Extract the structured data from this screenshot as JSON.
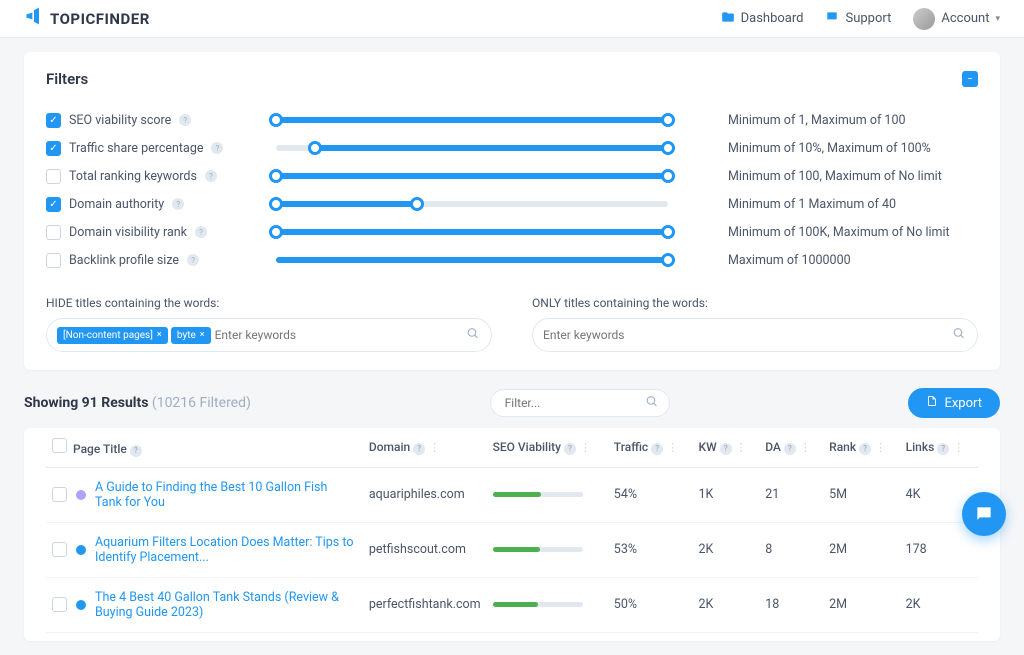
{
  "brand": "TOPICFINDER",
  "nav": {
    "dashboard": "Dashboard",
    "support": "Support",
    "account": "Account"
  },
  "filters": {
    "title": "Filters",
    "rows": [
      {
        "label": "SEO viability score",
        "checked": true,
        "fillLeft": 0,
        "fillRight": 100,
        "handles": [
          0,
          100
        ],
        "desc": "Minimum of 1, Maximum of 100"
      },
      {
        "label": "Traffic share percentage",
        "checked": true,
        "fillLeft": 10,
        "fillRight": 100,
        "handles": [
          10,
          100
        ],
        "desc": "Minimum of 10%, Maximum of 100%"
      },
      {
        "label": "Total ranking keywords",
        "checked": false,
        "fillLeft": 0,
        "fillRight": 100,
        "handles": [
          0,
          100
        ],
        "desc": "Minimum of 100, Maximum of No limit"
      },
      {
        "label": "Domain authority",
        "checked": true,
        "fillLeft": 0,
        "fillRight": 36,
        "handles": [
          0,
          36
        ],
        "desc": "Minimum of 1 Maximum of 40"
      },
      {
        "label": "Domain visibility rank",
        "checked": false,
        "fillLeft": 0,
        "fillRight": 100,
        "handles": [
          0,
          100
        ],
        "desc": "Minimum of 100K, Maximum of No limit"
      },
      {
        "label": "Backlink profile size",
        "checked": false,
        "fillLeft": 0,
        "fillRight": 100,
        "handles": [
          100
        ],
        "desc": "Maximum of 1000000"
      }
    ],
    "hide": {
      "label": "HIDE titles containing the words:",
      "tags": [
        "[Non-content pages]",
        "byte"
      ],
      "placeholder": "Enter keywords"
    },
    "only": {
      "label": "ONLY titles containing the words:",
      "placeholder": "Enter keywords"
    }
  },
  "results": {
    "showing": "Showing 91 Results",
    "filtered": "(10216 Filtered)",
    "filter_placeholder": "Filter...",
    "export": "Export",
    "columns": {
      "page_title": "Page Title",
      "domain": "Domain",
      "seo": "SEO Viability",
      "traffic": "Traffic",
      "kw": "KW",
      "da": "DA",
      "rank": "Rank",
      "links": "Links"
    },
    "rows": [
      {
        "title": "A Guide to Finding the Best 10 Gallon Fish Tank for You",
        "domain": "aquariphiles.com",
        "viability": 54,
        "traffic": "54%",
        "kw": "1K",
        "da": "21",
        "rank": "5M",
        "links": "4K",
        "fav": "#b0a0ff"
      },
      {
        "title": "Aquarium Filters Location Does Matter: Tips to Identify Placement...",
        "domain": "petfishscout.com",
        "viability": 53,
        "traffic": "53%",
        "kw": "2K",
        "da": "8",
        "rank": "2M",
        "links": "178",
        "fav": "#2196f3"
      },
      {
        "title": "The 4 Best 40 Gallon Tank Stands (Review & Buying Guide 2023)",
        "domain": "perfectfishtank.com",
        "viability": 50,
        "traffic": "50%",
        "kw": "2K",
        "da": "18",
        "rank": "2M",
        "links": "2K",
        "fav": "#2196f3"
      }
    ]
  }
}
